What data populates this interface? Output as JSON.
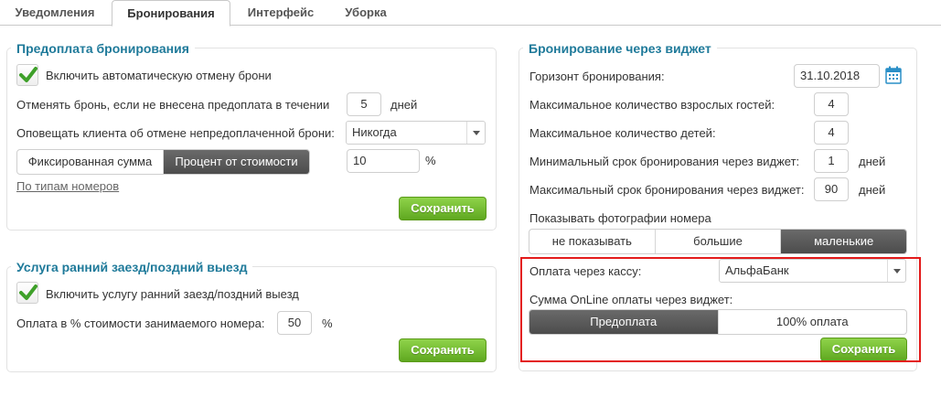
{
  "tabs": [
    {
      "label": "Уведомления",
      "active": false
    },
    {
      "label": "Бронирования",
      "active": true
    },
    {
      "label": "Интерфейс",
      "active": false
    },
    {
      "label": "Уборка",
      "active": false
    }
  ],
  "prepay": {
    "title": "Предоплата бронирования",
    "auto_cancel_label": "Включить автоматическую отмену брони",
    "auto_cancel_checked": true,
    "cancel_if_label": "Отменять бронь, если не внесена предоплата в течении",
    "cancel_days_value": "5",
    "days_unit": "дней",
    "notify_label": "Оповещать клиента об отмене непредоплаченной брони:",
    "notify_value": "Никогда",
    "mode_options": [
      "Фиксированная сумма",
      "Процент от стоимости"
    ],
    "mode_selected": 1,
    "percent_value": "10",
    "percent_unit": "%",
    "by_room_types_link": "По типам номеров",
    "save_label": "Сохранить"
  },
  "early": {
    "title": "Услуга ранний заезд/поздний выезд",
    "enable_label": "Включить услугу ранний заезд/поздний выезд",
    "enable_checked": true,
    "percent_label": "Оплата в % стоимости занимаемого номера:",
    "percent_value": "50",
    "percent_unit": "%",
    "save_label": "Сохранить"
  },
  "widget": {
    "title": "Бронирование через виджет",
    "horizon_label": "Горизонт бронирования:",
    "horizon_value": "31.10.2018",
    "max_adults_label": "Максимальное количество взрослых гостей:",
    "max_adults_value": "4",
    "max_children_label": "Максимальное количество детей:",
    "max_children_value": "4",
    "min_term_label": "Минимальный срок бронирования через виджет:",
    "min_term_value": "1",
    "max_term_label": "Максимальный срок бронирования через виджет:",
    "max_term_value": "90",
    "days_unit": "дней",
    "photos_label": "Показывать фотографии номера",
    "photo_options": [
      "не показывать",
      "большие",
      "маленькие"
    ],
    "photo_selected": 2,
    "cashbox_label": "Оплата через кассу:",
    "cashbox_value": "АльфаБанк",
    "online_label": "Сумма OnLine оплаты через виджет:",
    "online_options": [
      "Предоплата",
      "100% оплата"
    ],
    "online_selected": 0,
    "save_label": "Сохранить"
  },
  "colors": {
    "title": "#1f7a9a",
    "green": "#5fa820",
    "highlight": "#e31b1b",
    "selected_segment": "#4c4c4c"
  }
}
